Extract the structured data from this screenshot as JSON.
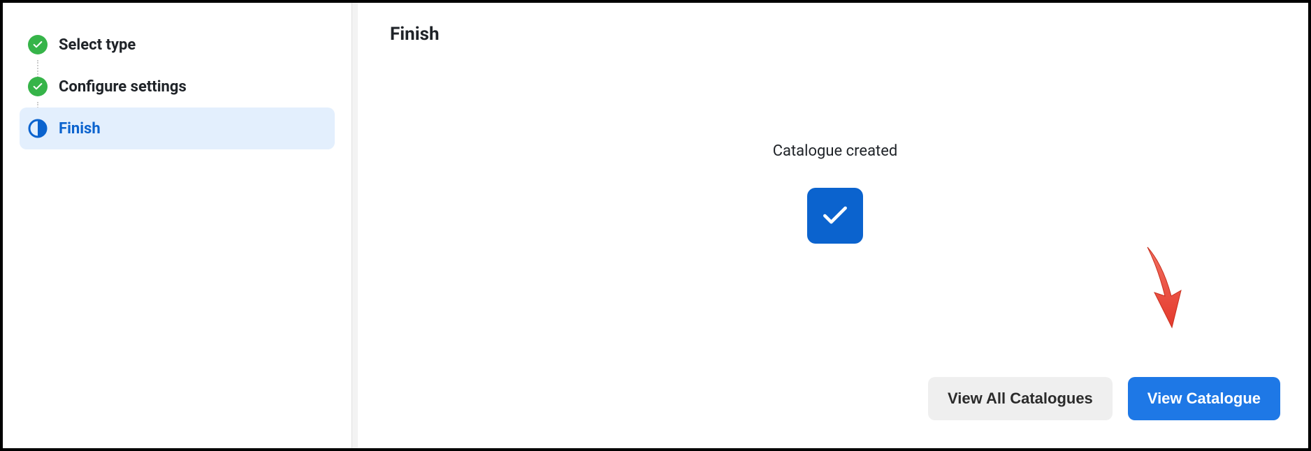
{
  "sidebar": {
    "steps": [
      {
        "label": "Select type",
        "status": "completed"
      },
      {
        "label": "Configure settings",
        "status": "completed"
      },
      {
        "label": "Finish",
        "status": "current"
      }
    ]
  },
  "main": {
    "title": "Finish",
    "success_message": "Catalogue created"
  },
  "buttons": {
    "view_all": "View All Catalogues",
    "view_one": "View Catalogue"
  },
  "colors": {
    "completed_green": "#36b449",
    "primary_blue": "#0b63ce",
    "button_blue": "#1e78e6",
    "active_bg": "#e3effd",
    "secondary_bg": "#efefef",
    "annotation_red": "#ee4b3e"
  }
}
